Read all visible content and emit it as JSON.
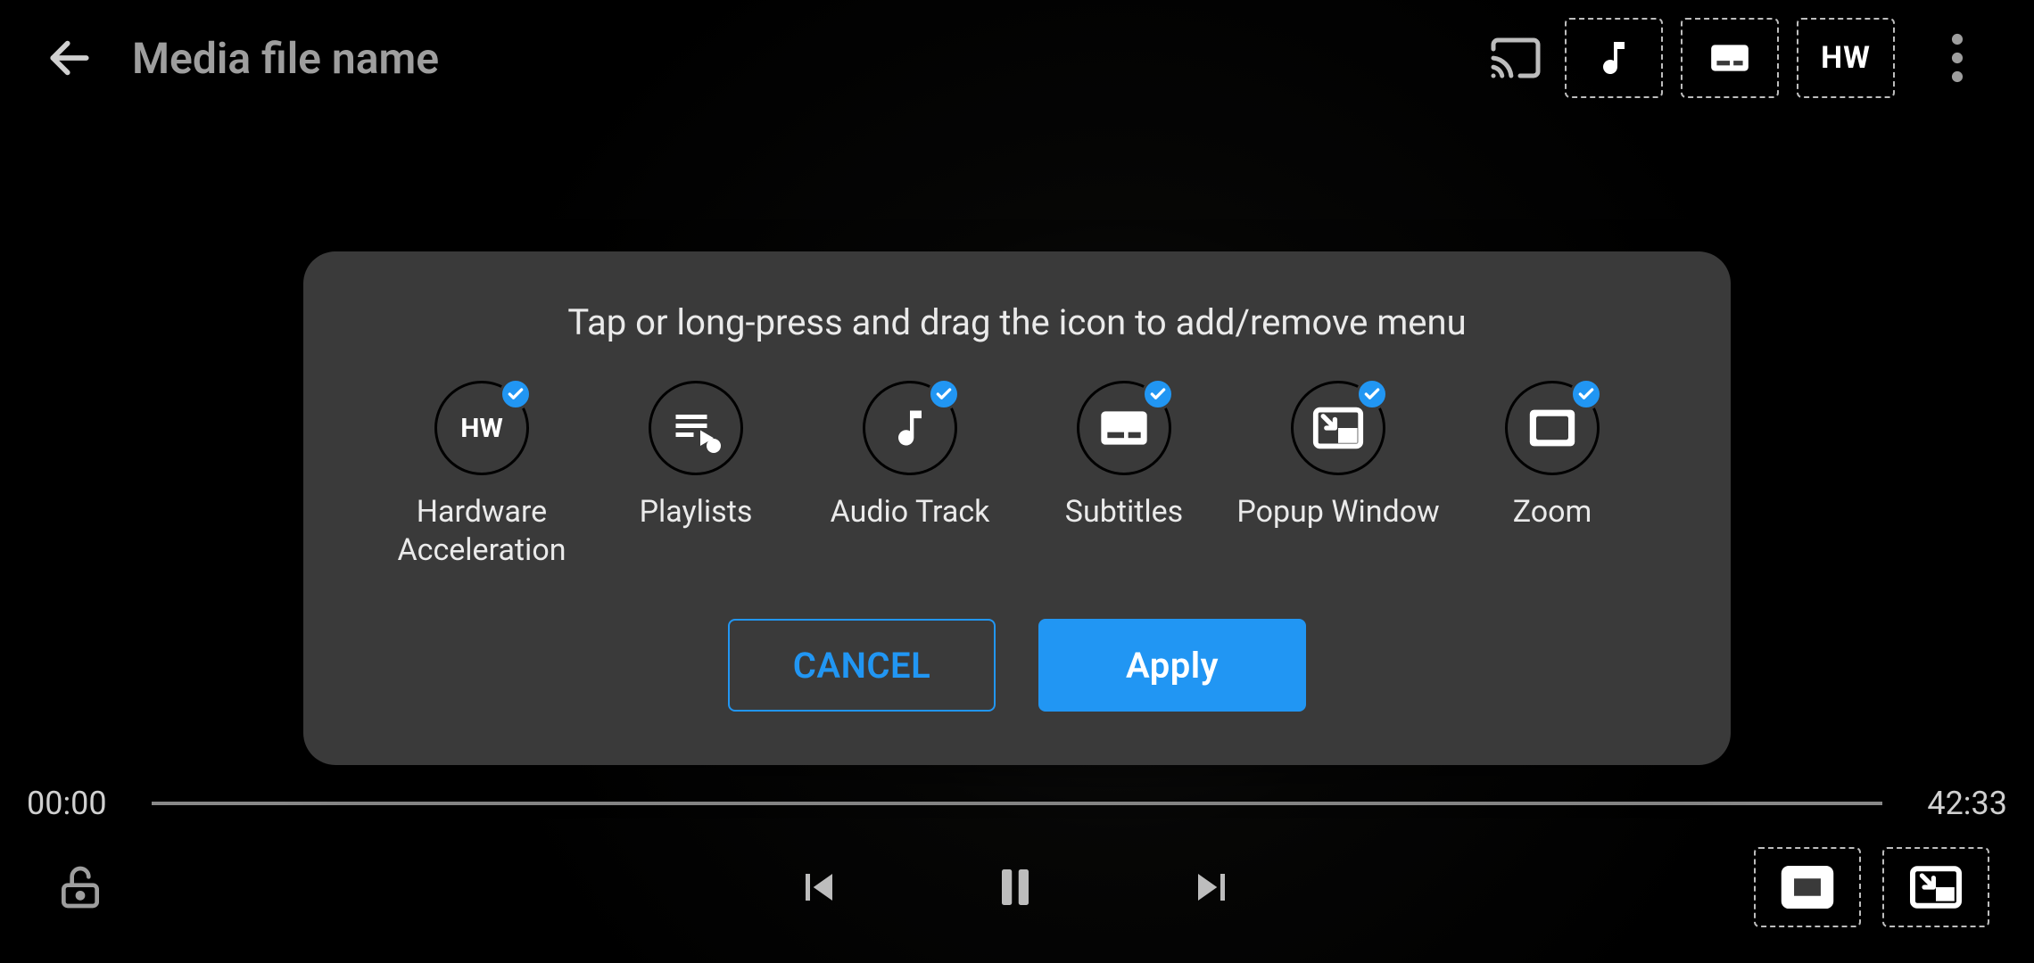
{
  "header": {
    "title": "Media file name",
    "hw_label": "HW"
  },
  "playback": {
    "current_time": "00:00",
    "duration": "42:33"
  },
  "dialog": {
    "instructions": "Tap or long-press and drag the icon to add/remove menu",
    "options": {
      "hardware_acceleration": {
        "label": "Hardware Acceleration",
        "hw_text": "HW",
        "checked": true
      },
      "playlists": {
        "label": "Playlists",
        "checked": false
      },
      "audio_track": {
        "label": "Audio Track",
        "checked": true
      },
      "subtitles": {
        "label": "Subtitles",
        "checked": true
      },
      "popup_window": {
        "label": "Popup Window",
        "checked": true
      },
      "zoom": {
        "label": "Zoom",
        "checked": true
      }
    },
    "buttons": {
      "cancel": "CANCEL",
      "apply": "Apply"
    }
  },
  "colors": {
    "accent": "#2196f3"
  }
}
